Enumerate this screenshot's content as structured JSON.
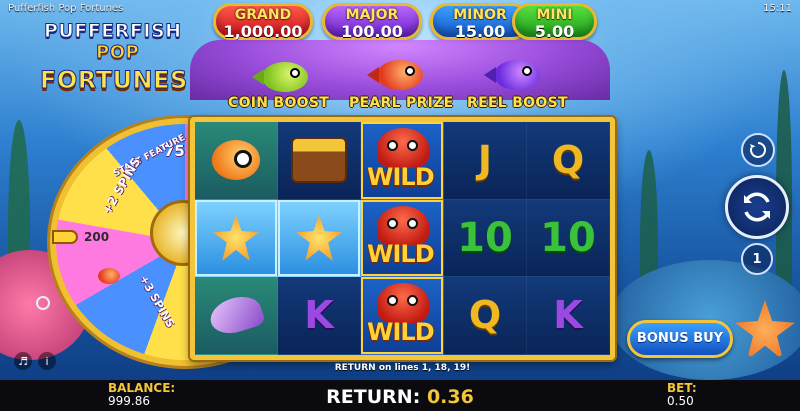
{
  "window": {
    "title": "Pufferfish Pop Fortunes",
    "clock": "15:11"
  },
  "logo": {
    "line1": "PUFFERFISH",
    "line2": "POP",
    "line3": "FORTUNES"
  },
  "jackpots": [
    {
      "name": "GRAND",
      "value": "1,000.00",
      "color": "#c8101c"
    },
    {
      "name": "MAJOR",
      "value": "100.00",
      "color": "#6a22c8"
    },
    {
      "name": "MINOR",
      "value": "15.00",
      "color": "#1256c6"
    },
    {
      "name": "MINI",
      "value": "5.00",
      "color": "#1f9a1a"
    }
  ],
  "features": [
    {
      "label": "COIN BOOST",
      "fish": "green-pufferfish"
    },
    {
      "label": "PEARL PRIZE",
      "fish": "red-pufferfish"
    },
    {
      "label": "REEL BOOST",
      "fish": "purple-pufferfish"
    }
  ],
  "wheel": {
    "segments": [
      "75",
      "START FEATURE",
      "+2 SPINS",
      "200",
      "+3 SPINS"
    ],
    "start_feature": "START\nFEATURE",
    "spins_plus2": "+2\nSPINS",
    "spins_plus3": "+3\nSPINS"
  },
  "reels": {
    "rows": [
      [
        "goldfish",
        "treasure-chest",
        "WILD",
        "J",
        "Q"
      ],
      [
        "starfish",
        "starfish",
        "WILD",
        "10",
        "10"
      ],
      [
        "shell",
        "K",
        "WILD",
        "Q",
        "K"
      ]
    ],
    "wild_label": "WILD"
  },
  "win_line": "RETURN on lines 1, 18, 19!",
  "controls": {
    "autoplay_icon": "autoplay-icon",
    "spin_icon": "spin-icon",
    "bet_level": "1"
  },
  "bonus_buy_label": "BONUS BUY",
  "bottom": {
    "balance_label": "BALANCE:",
    "balance_value": "999.86",
    "return_label": "RETURN:",
    "return_value": "0.36",
    "bet_label": "BET:",
    "bet_value": "0.50"
  },
  "colors": {
    "frame_gold": "#f3c53a",
    "reel_bg": "#0d2f68",
    "accent": "#3aa0ff"
  }
}
